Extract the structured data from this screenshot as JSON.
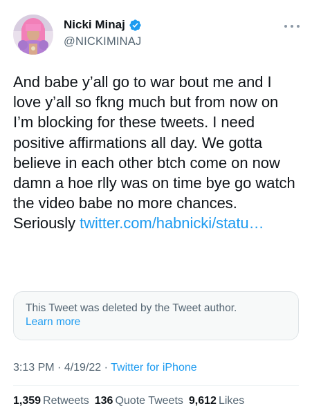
{
  "author": {
    "display_name": "Nicki Minaj",
    "handle": "@NICKIMINAJ",
    "verified": true,
    "avatar_icon": "profile-photo"
  },
  "tweet": {
    "text": "And babe y’all go to war bout me and I love y’all so fkng much but from now on I’m blocking for these tweets. I need positive affirmations all day. We gotta believe in each other btch come on now damn a hoe rlly was on time bye go watch the video babe no more chances. Seriously ",
    "link_text": "twitter.com/habnicki/statu…"
  },
  "quoted": {
    "deleted_message": "This Tweet was deleted by the Tweet author.",
    "learn_more": "Learn more"
  },
  "meta": {
    "time": "3:13 PM",
    "separator": " · ",
    "date": "4/19/22",
    "source": "Twitter for iPhone"
  },
  "stats": {
    "retweets_count": "1,359",
    "retweets_label": "Retweets",
    "quote_count": "136",
    "quote_label": "Quote Tweets",
    "likes_count": "9,612",
    "likes_label": "Likes"
  },
  "colors": {
    "accent": "#1d9bf0",
    "text": "#0f1419",
    "secondary": "#536471",
    "card_bg": "#f7f9f9"
  }
}
